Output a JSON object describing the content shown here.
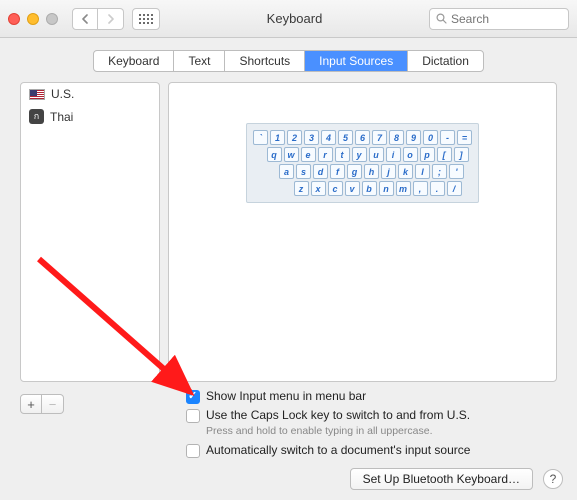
{
  "window": {
    "title": "Keyboard"
  },
  "search": {
    "placeholder": "Search"
  },
  "tabs": {
    "keyboard": "Keyboard",
    "text": "Text",
    "shortcuts": "Shortcuts",
    "input_sources": "Input Sources",
    "dictation": "Dictation"
  },
  "sources": {
    "us": "U.S.",
    "thai": "Thai",
    "thai_glyph": "ก"
  },
  "keyboard_rows": [
    [
      "`",
      "1",
      "2",
      "3",
      "4",
      "5",
      "6",
      "7",
      "8",
      "9",
      "0",
      "-",
      "="
    ],
    [
      "q",
      "w",
      "e",
      "r",
      "t",
      "y",
      "u",
      "i",
      "o",
      "p",
      "[",
      "]"
    ],
    [
      "a",
      "s",
      "d",
      "f",
      "g",
      "h",
      "j",
      "k",
      "l",
      ";",
      "'"
    ],
    [
      "z",
      "x",
      "c",
      "v",
      "b",
      "n",
      "m",
      ",",
      ".",
      "/"
    ]
  ],
  "options": {
    "show_menu": "Show Input menu in menu bar",
    "caps_lock": "Use the Caps Lock key to switch to and from U.S.",
    "caps_note": "Press and hold to enable typing in all uppercase.",
    "auto_switch": "Automatically switch to a document's input source"
  },
  "buttons": {
    "bluetooth": "Set Up Bluetooth Keyboard…",
    "help": "?"
  }
}
